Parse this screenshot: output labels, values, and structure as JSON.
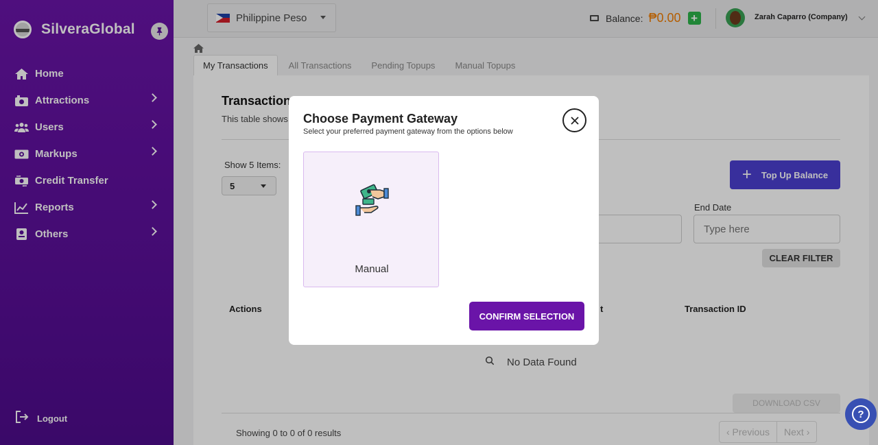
{
  "app": {
    "brand_name": "SilveraGlobal"
  },
  "sidebar": {
    "items": [
      {
        "label": "Home",
        "icon": "home-icon"
      },
      {
        "label": "Attractions",
        "icon": "attractions-icon"
      },
      {
        "label": "Users",
        "icon": "users-icon"
      },
      {
        "label": "Markups",
        "icon": "markups-icon"
      },
      {
        "label": "Credit Transfer",
        "icon": "credit-transfer-icon"
      },
      {
        "label": "Reports",
        "icon": "reports-icon"
      },
      {
        "label": "Others",
        "icon": "others-icon"
      }
    ],
    "logout_label": "Logout"
  },
  "topbar": {
    "currency": "Philippine Peso",
    "balance_label": "Balance:",
    "balance_value": "₱0.00",
    "user_name": "Zarah Caparro (Company)"
  },
  "tabs": [
    "My Transactions",
    "All Transactions",
    "Pending Topups",
    "Manual Topups"
  ],
  "panel": {
    "title": "Transaction",
    "subtitle": "This table shows",
    "show_label": "Show 5 Items:",
    "show_value": "5",
    "topup_label": "Top Up Balance",
    "end_date_label": "End Date",
    "end_date_placeholder": "Type here",
    "clear_filter": "CLEAR FILTER",
    "columns": {
      "actions": "Actions",
      "partial": "t",
      "transaction_id": "Transaction ID"
    },
    "no_data": "No Data Found",
    "download": "DOWNLOAD CSV",
    "showing": "Showing 0 to 0 of 0 results",
    "prev": "‹ Previous",
    "next": "Next ›"
  },
  "modal": {
    "title": "Choose Payment Gateway",
    "subtitle": "Select your preferred payment gateway from the options below",
    "option_label": "Manual",
    "confirm_label": "CONFIRM SELECTION"
  },
  "colors": {
    "sidebar": "#5a0f99",
    "accent": "#6a14a8",
    "topup": "#4b3fd1",
    "balance": "#f07c00",
    "help": "#3850b3"
  }
}
